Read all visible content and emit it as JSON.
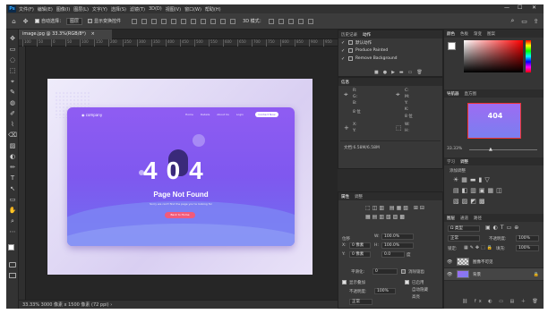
{
  "menubar": {
    "logo": "Ps",
    "items": [
      "文件(F)",
      "编辑(E)",
      "图像(I)",
      "图层(L)",
      "文字(Y)",
      "选择(S)",
      "滤镜(T)",
      "3D(D)",
      "视图(V)",
      "窗口(W)",
      "帮助(H)"
    ],
    "min_icon": "—",
    "max_icon": "☐",
    "close_icon": "✕"
  },
  "options": {
    "home_icon": "⌂",
    "move_icon": "✥",
    "auto_select_label": "自动选择：",
    "auto_select_value": "图层",
    "show_transform_label": "显示变换控件",
    "mode_3d_label": "3D 模式：",
    "search_icon": "⌕",
    "workspace_icon": "▭",
    "share_icon": "⇪"
  },
  "document": {
    "tab_title": "image.jpg @ 33.3%(RGB/8*)",
    "close_icon": "×"
  },
  "ruler": {
    "top": [
      "100",
      "50",
      "0",
      "50",
      "100",
      "150",
      "200",
      "250",
      "300",
      "350",
      "400",
      "450",
      "500",
      "550",
      "600",
      "650",
      "700",
      "750",
      "800",
      "850",
      "900",
      "950"
    ]
  },
  "status": {
    "text": "33.33%   3000 像素 x 1500 像素 (72 ppi)   ›"
  },
  "artwork": {
    "logo": "◉ company",
    "nav": [
      "Home",
      "Details",
      "About Us",
      "Login"
    ],
    "cta": "Contact Now",
    "code": "404",
    "headline": "Page Not Found",
    "subline": "Sorry we can't find the page you're looking for",
    "home_button": "Back to Home"
  },
  "history_panel": {
    "tabs": [
      "历史记录",
      "动作"
    ],
    "rows": [
      {
        "label": "默认动作",
        "checked": true
      },
      {
        "label": "Produce Painted",
        "checked": true
      },
      {
        "label": "Remove Background",
        "checked": true
      }
    ]
  },
  "info_panel": {
    "title": "信息",
    "labels": [
      "R:",
      "G:",
      "B:",
      "8 位",
      "C:",
      "M:",
      "Y:",
      "K:",
      "8 位",
      "X:",
      "Y:",
      "W:",
      "H:"
    ],
    "doc_size": "文档:6.58M/6.58M"
  },
  "properties_panel": {
    "tabs": [
      "属性",
      "调整"
    ],
    "transform_title": "变换",
    "w_label": "W:",
    "w_value": "100.0%",
    "h_label": "H:",
    "h_value": "100.0%",
    "x_label": "X:",
    "x_value": "0 像素",
    "y_label": "Y:",
    "y_value": "0 像素",
    "angle_value": "0.0",
    "angle_unit": "度",
    "offset_label": "位移",
    "smooth_label": "平滑化:",
    "smooth_value": "0",
    "antialias_label": "消除锯齿",
    "show_overlay_label": "显示叠加",
    "opacity_label": "不透明度:",
    "opacity_value": "100%",
    "normal_value": "正常",
    "enabled_label": "已启用",
    "auto_hide_label": "自动隐藏",
    "highlight_label": "高亮"
  },
  "color_panel": {
    "tabs": [
      "颜色",
      "色板",
      "渐变",
      "图案"
    ],
    "fg_color": "#ffffff"
  },
  "navigator_panel": {
    "tabs": [
      "导航器",
      "直方图"
    ],
    "zoom": "33.33%",
    "thumb_text": "404"
  },
  "adjustments_panel": {
    "tabs": [
      "学习",
      "调整"
    ],
    "title": "添加调整",
    "row1": "☀▦▬▮▽",
    "row2": "▤◧▥▣▦◫",
    "row3": "▧▨◩▩"
  },
  "layers_panel": {
    "tabs": [
      "图层",
      "通道",
      "路径"
    ],
    "kind_label": "Ω 类型",
    "mode_value": "正常",
    "opacity_label": "不透明度:",
    "opacity_value": "100%",
    "lock_label": "锁定:",
    "fill_label": "填充:",
    "fill_value": "100%",
    "layers": [
      {
        "name": "图像不可见"
      },
      {
        "name": "背景"
      }
    ],
    "bottom_icons": "⛓ fx ◐ ▭ ▤ ＋ 🗑"
  },
  "tools": [
    "✥",
    "▭",
    "◌",
    "⬚",
    "⌖",
    "✎",
    "◍",
    "✐",
    "⌇",
    "⌫",
    "▨",
    "◐",
    "✏",
    "T",
    "↖",
    "▭",
    "✋",
    "⌕",
    "⋯"
  ]
}
